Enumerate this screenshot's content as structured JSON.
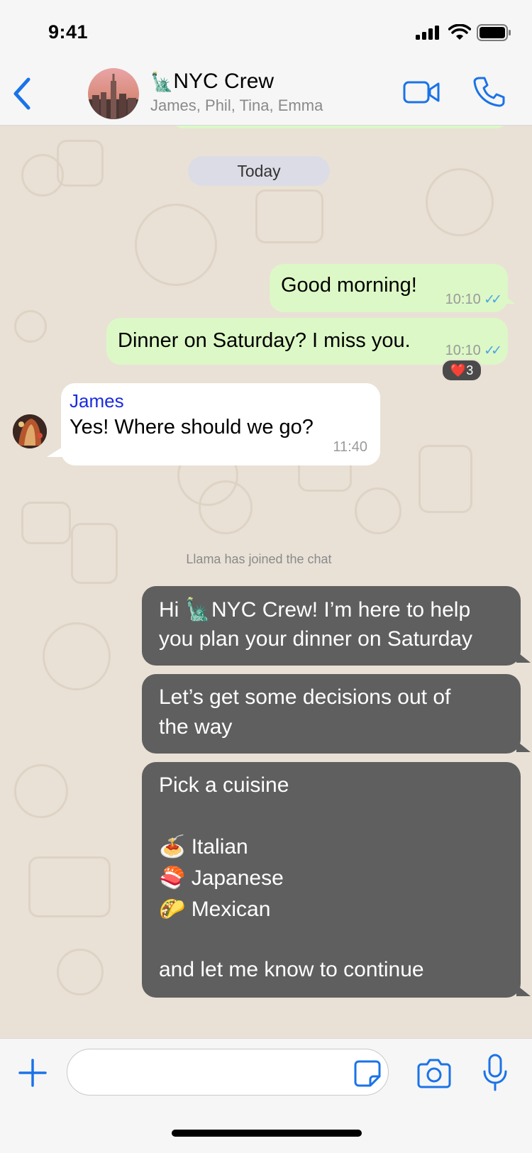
{
  "status_bar": {
    "time": "9:41"
  },
  "header": {
    "title_emoji": "🗽",
    "title": "NYC Crew",
    "members": "James, Phil, Tina, Emma",
    "icons": {
      "back": "chevron-left-icon",
      "video": "video-camera-icon",
      "voice": "phone-icon"
    }
  },
  "chat": {
    "date_label": "Today",
    "messages": [
      {
        "text": "Good morning!",
        "time": "10:10",
        "status": "read"
      },
      {
        "text": "Dinner on Saturday? I miss you.",
        "time": "10:10",
        "status": "read",
        "reaction": "❤️",
        "reaction_count": "3"
      },
      {
        "sender": "James",
        "text": "Yes! Where should we go?",
        "time": "11:40"
      }
    ],
    "system_note": "Llama has joined the chat",
    "bot_messages": [
      {
        "lines": [
          "Hi 🗽NYC Crew! I’m here to help",
          "you plan your dinner on Saturday"
        ]
      },
      {
        "lines": [
          "Let’s get some decisions out of",
          "the way"
        ]
      },
      {
        "lines": [
          "Pick a cuisine",
          "",
          "🍝 Italian",
          "🍣 Japanese",
          "🌮 Mexican",
          "",
          "and let me know to continue"
        ]
      }
    ]
  },
  "composer": {
    "placeholder": "",
    "icons": {
      "add": "plus-icon",
      "sticker": "sticker-icon",
      "camera": "camera-icon",
      "mic": "microphone-icon"
    }
  },
  "colors": {
    "accent": "#1a73e8",
    "outgoing_bubble": "#dcf8c6",
    "bot_bubble": "#5f5f5f",
    "chat_background": "#e9e1d6",
    "sender_name": "#1b2be0",
    "read_ticks": "#4fa3e6"
  }
}
